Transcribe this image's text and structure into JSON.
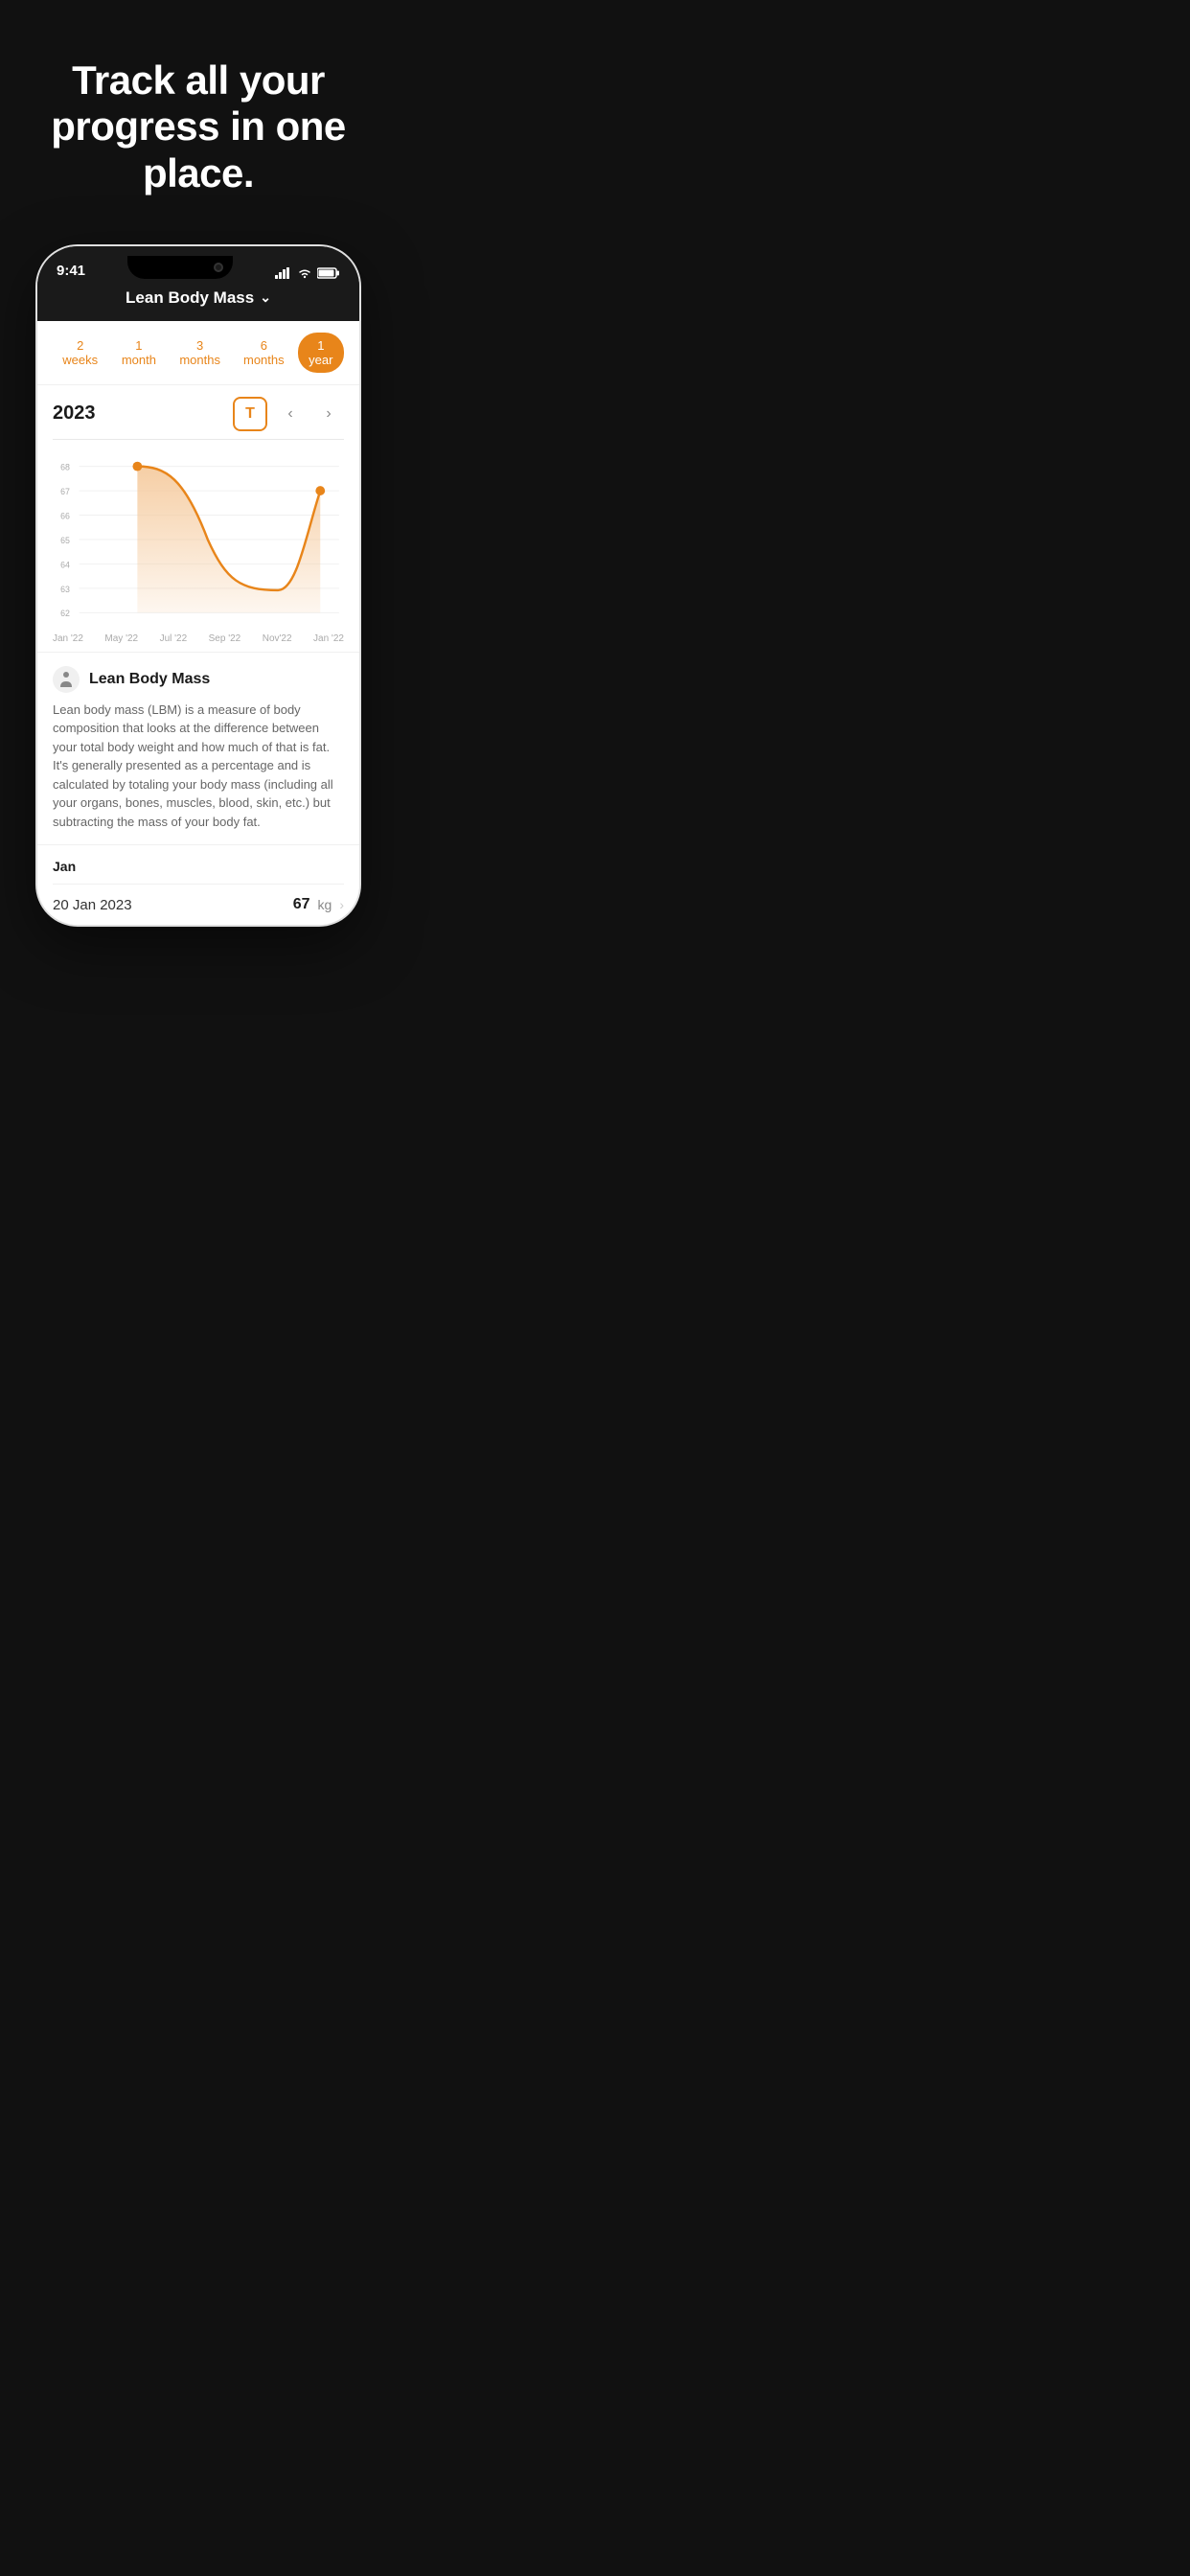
{
  "hero": {
    "title": "Track all your progress in one place."
  },
  "phone": {
    "status": {
      "time": "9:41",
      "signal": "▐▐▐▐",
      "wifi": "wifi",
      "battery": "battery"
    },
    "header": {
      "title": "Lean Body Mass",
      "chevron": "∨"
    },
    "filters": [
      {
        "label": "2 weeks",
        "active": false
      },
      {
        "label": "1 month",
        "active": false
      },
      {
        "label": "3 months",
        "active": false
      },
      {
        "label": "6 months",
        "active": false
      },
      {
        "label": "1 year",
        "active": true
      }
    ],
    "chart": {
      "year": "2023",
      "t_button": "T",
      "x_labels": [
        "Jan '22",
        "May '22",
        "Jul '22",
        "Sep '22",
        "Nov'22",
        "Jan '22"
      ],
      "y_values": [
        "68",
        "67",
        "66",
        "65",
        "64",
        "63",
        "62"
      ]
    },
    "info": {
      "title": "Lean Body Mass",
      "description": "Lean body mass (LBM) is a measure of body composition that looks at the difference between your total body weight and how much of that is fat. It's generally presented as a percentage and is calculated by totaling your body mass (including all your organs, bones, muscles, blood, skin, etc.) but subtracting the mass of your body fat."
    },
    "data": {
      "month_label": "Jan",
      "entries": [
        {
          "date": "20 Jan 2023",
          "value": "67",
          "unit": "kg"
        }
      ]
    }
  }
}
